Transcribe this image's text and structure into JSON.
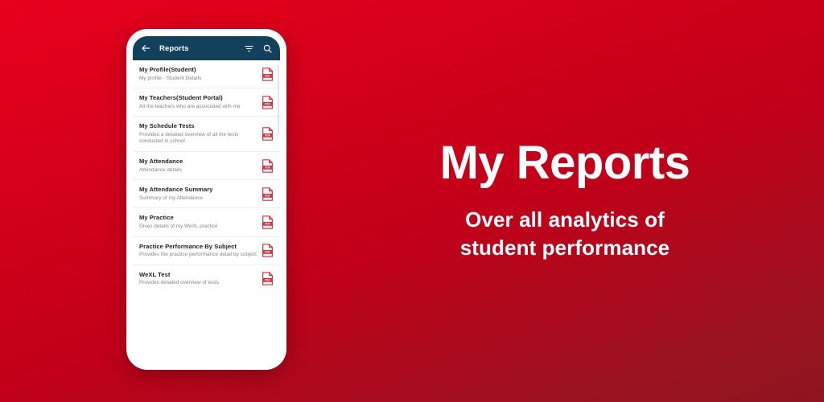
{
  "theme": {
    "background_gradient_start": "#e8001c",
    "background_gradient_end": "#8e1520",
    "app_bar_color": "#11415d",
    "pdf_icon_color": "#d32f3c",
    "promo_text_color": "#ffffff"
  },
  "phone": {
    "app_bar": {
      "back_icon": "back-arrow-icon",
      "title": "Reports",
      "filter_icon": "filter-icon",
      "search_icon": "search-icon"
    },
    "list": {
      "items": [
        {
          "title": "My Profile(Student)",
          "subtitle": "My profile - Student Details",
          "icon": "pdf-icon",
          "icon_label": "PDF"
        },
        {
          "title": "My Teachers(Student Portal)",
          "subtitle": "All the teachers who are associated with me",
          "icon": "pdf-icon",
          "icon_label": "PDF"
        },
        {
          "title": "My Schedule Tests",
          "subtitle": "Provides a detailed overview of all the tests conducted in school",
          "icon": "pdf-icon",
          "icon_label": "PDF"
        },
        {
          "title": "My Attendance",
          "subtitle": "Attendance details",
          "icon": "pdf-icon",
          "icon_label": "PDF"
        },
        {
          "title": "My Attendance Summary",
          "subtitle": "Summary of my Attendance",
          "icon": "pdf-icon",
          "icon_label": "PDF"
        },
        {
          "title": "My Practice",
          "subtitle": "Gives details of my WeXL practice",
          "icon": "pdf-icon",
          "icon_label": "PDF"
        },
        {
          "title": "Practice Performance By Subject",
          "subtitle": "Provides the practice performance detail by subject",
          "icon": "pdf-icon",
          "icon_label": "PDF"
        },
        {
          "title": "WeXL Test",
          "subtitle": "Provides detailed overview of tests",
          "icon": "pdf-icon",
          "icon_label": "PDF"
        }
      ]
    }
  },
  "promo": {
    "heading": "My Reports",
    "subtitle_line1": "Over all analytics of",
    "subtitle_line2": "student performance"
  }
}
